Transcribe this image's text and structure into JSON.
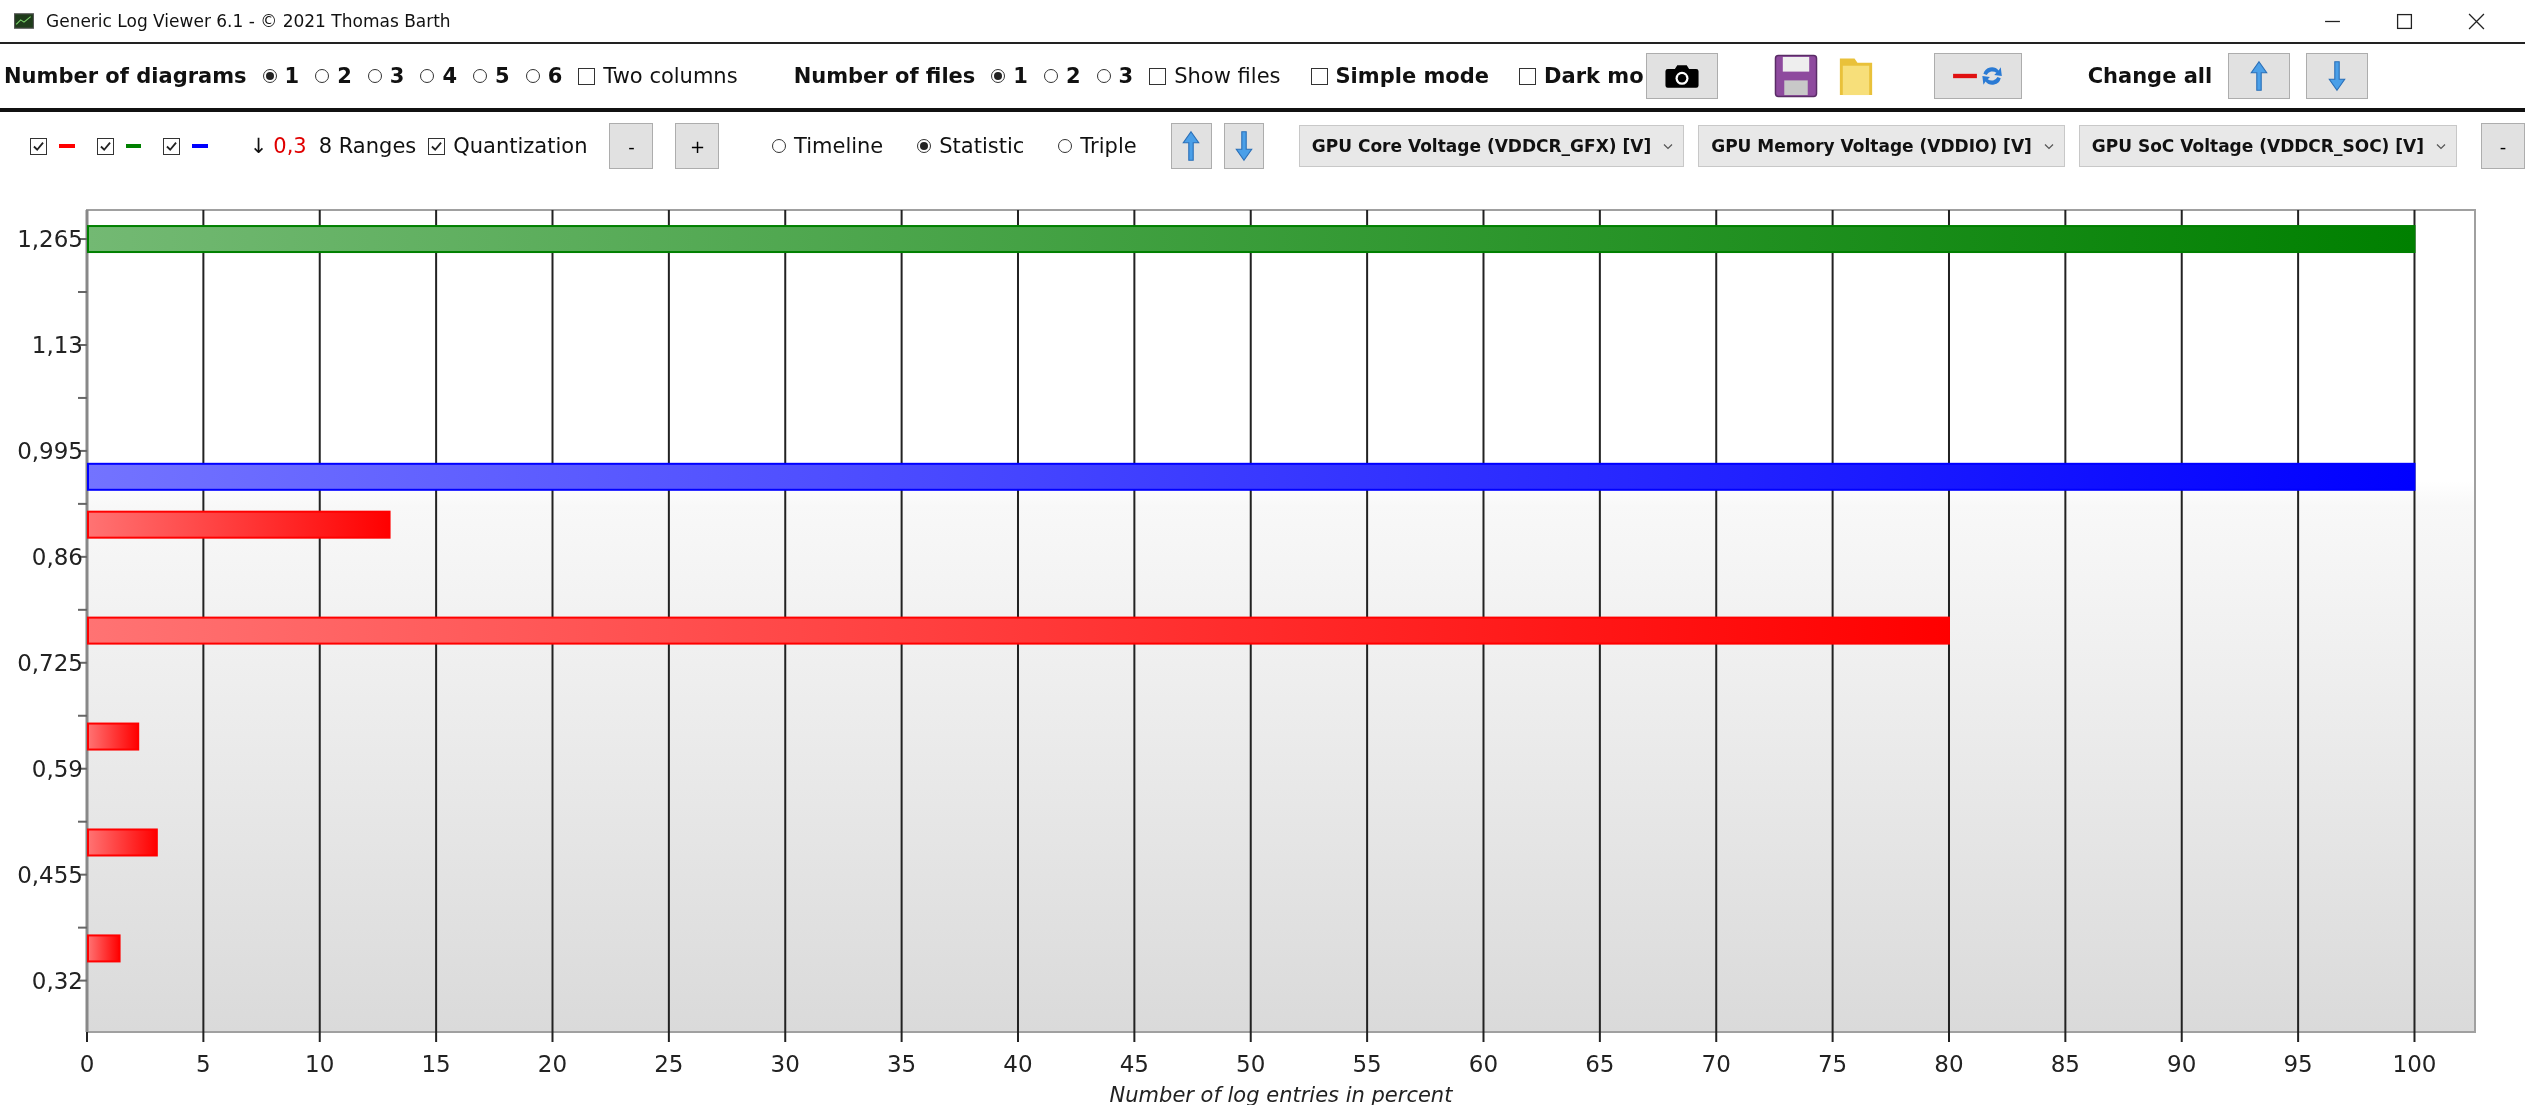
{
  "window": {
    "title": "Generic Log Viewer 6.1 - © 2021 Thomas Barth"
  },
  "toolbar": {
    "diagrams_label": "Number of diagrams",
    "diagram_options": [
      {
        "label": "1",
        "selected": true
      },
      {
        "label": "2",
        "selected": false
      },
      {
        "label": "3",
        "selected": false
      },
      {
        "label": "4",
        "selected": false
      },
      {
        "label": "5",
        "selected": false
      },
      {
        "label": "6",
        "selected": false
      }
    ],
    "two_columns": {
      "label": "Two columns",
      "checked": false
    },
    "files_label": "Number of files",
    "file_options": [
      {
        "label": "1",
        "selected": true
      },
      {
        "label": "2",
        "selected": false
      },
      {
        "label": "3",
        "selected": false
      }
    ],
    "show_files": {
      "label": "Show files",
      "checked": false
    },
    "simple_mode": {
      "label": "Simple mode",
      "checked": false
    },
    "dark_mode": {
      "label": "Dark mo",
      "checked": false
    },
    "change_all_label": "Change all"
  },
  "diagram_bar": {
    "series_toggles": [
      {
        "checked": true,
        "color": "#ff0000"
      },
      {
        "checked": true,
        "color": "#008000"
      },
      {
        "checked": true,
        "color": "#0000ff"
      }
    ],
    "step_arrow": "↓",
    "step": "0,3",
    "ranges": "8 Ranges",
    "quantization": {
      "label": "Quantization",
      "checked": true
    },
    "minus_button": "-",
    "plus_button": "+",
    "modes": [
      {
        "label": "Timeline",
        "selected": false
      },
      {
        "label": "Statistic",
        "selected": true
      },
      {
        "label": "Triple",
        "selected": false
      }
    ],
    "dropdowns": [
      {
        "value": "GPU Core Voltage (VDDCR_GFX) [V]"
      },
      {
        "value": "GPU Memory Voltage (VDDIO) [V]"
      },
      {
        "value": "GPU SoC Voltage (VDDCR_SOC) [V]"
      }
    ],
    "remove_button": "-"
  },
  "chart": {
    "chart_data": {
      "type": "bar",
      "orientation": "horizontal",
      "xlabel": "Number of log entries in percent",
      "x": [
        1.265,
        0.962,
        0.901,
        0.766,
        0.631,
        0.496,
        0.361
      ],
      "series": [
        {
          "color": "#ff0000",
          "values": [
            null,
            null,
            13,
            80,
            2.2,
            3,
            1.4
          ]
        },
        {
          "color": "#008000",
          "values": [
            100,
            null,
            null,
            null,
            null,
            null,
            null
          ]
        },
        {
          "color": "#0000ff",
          "values": [
            null,
            100,
            null,
            null,
            null,
            null,
            null
          ]
        }
      ],
      "grid": true,
      "xlim": [
        0,
        102.6
      ],
      "ylim": [
        0.2545,
        1.302
      ],
      "xticks": [
        0,
        5,
        10,
        15,
        20,
        25,
        30,
        35,
        40,
        45,
        50,
        55,
        60,
        65,
        70,
        75,
        80,
        85,
        90,
        95,
        100
      ],
      "yticks": [
        {
          "value": 1.265,
          "label": "1,265"
        },
        {
          "value": 1.13,
          "label": "1,13"
        },
        {
          "value": 0.995,
          "label": "0,995"
        },
        {
          "value": 0.86,
          "label": "0,86"
        },
        {
          "value": 0.725,
          "label": "0,725"
        },
        {
          "value": 0.59,
          "label": "0,59"
        },
        {
          "value": 0.455,
          "label": "0,455"
        },
        {
          "value": 0.32,
          "label": "0,32"
        }
      ]
    }
  }
}
